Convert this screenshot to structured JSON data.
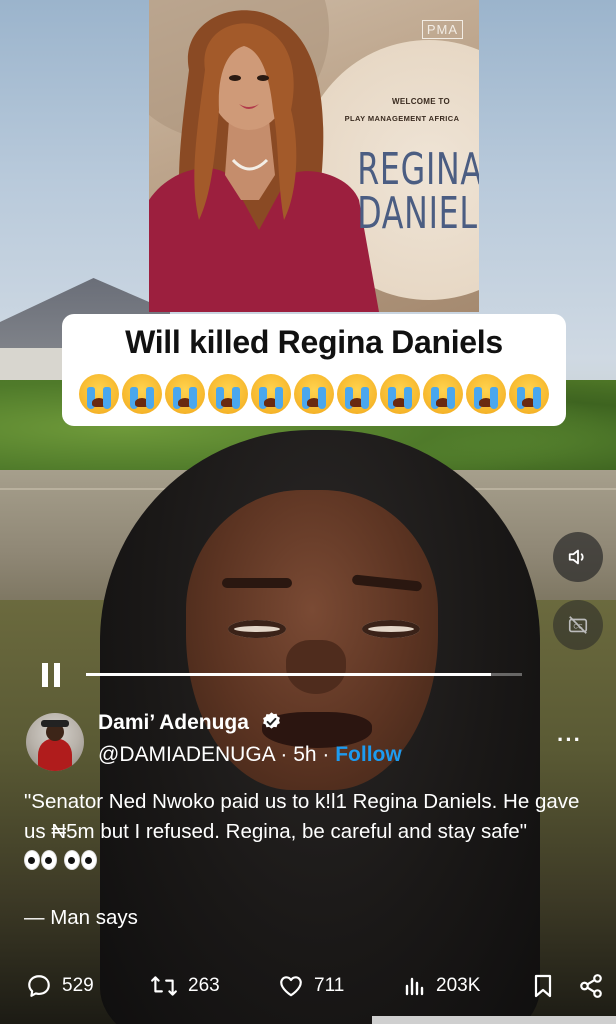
{
  "poster": {
    "badge": "PMA",
    "welcome_line1": "WELCOME TO",
    "welcome_line2": "PLAY MANAGEMENT AFRICA",
    "title_line1": "REGINA",
    "title_line2": "DANIELS"
  },
  "caption": {
    "text": "Will killed Regina Daniels",
    "emoji_count": 11,
    "emoji_icon": "loudly-crying-face-icon"
  },
  "video": {
    "progress": 0.93,
    "volume_icon": "speaker-icon",
    "captions_icon": "captions-off-icon",
    "pause_icon": "pause-icon"
  },
  "tweet": {
    "display_name": "Dami’ Adenuga",
    "handle": "@DAMIADENUGA",
    "separator": " · ",
    "time": "5h",
    "follow_label": "Follow",
    "more_label": "···",
    "text": "\"Senator Ned Nwoko paid us to k!l1 Regina Daniels. He gave us ₦5m but I refused. Regina, be careful and stay safe\"",
    "byline": "— Man says"
  },
  "actions": {
    "replies": "529",
    "reposts": "263",
    "likes": "711",
    "views": "203K"
  },
  "colors": {
    "accent": "#1d9bf0",
    "verified": "#ffffff"
  }
}
